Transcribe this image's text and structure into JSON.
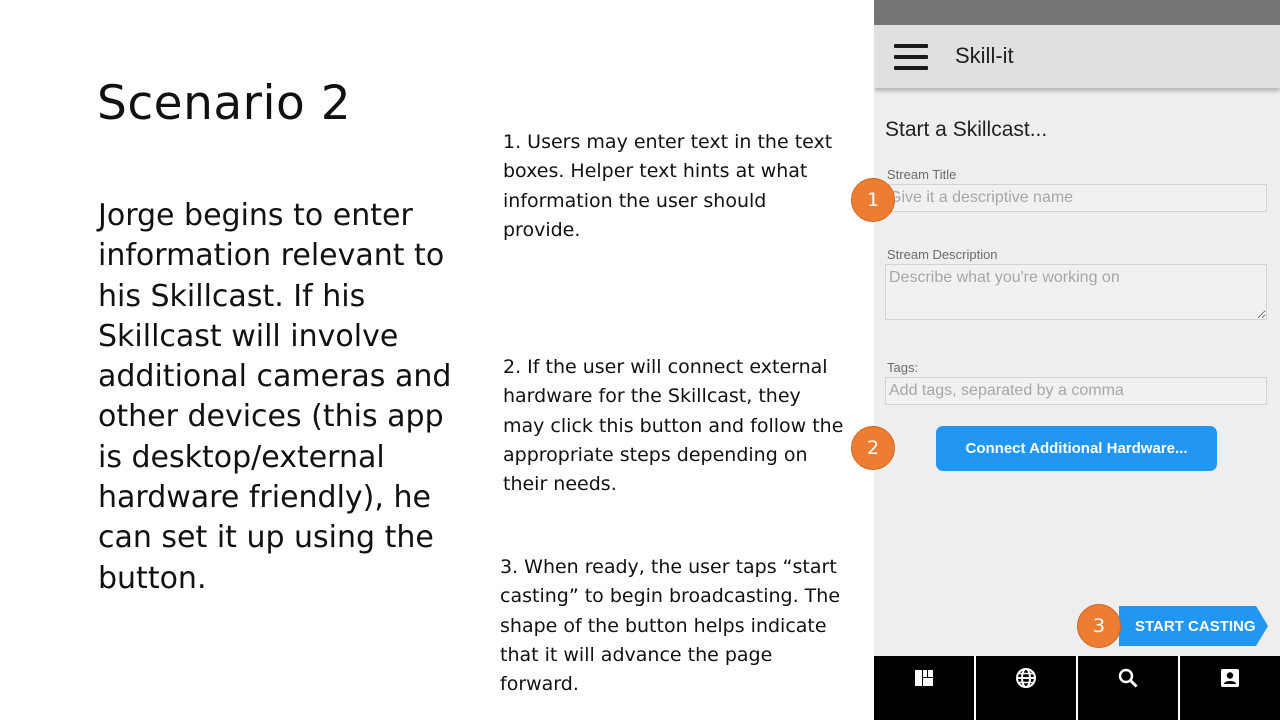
{
  "slide": {
    "title": "Scenario 2",
    "body": "Jorge begins to enter information relevant to his Skillcast. If his Skillcast will involve additional cameras and other devices (this app is desktop/external hardware friendly), he can set it up using the button.",
    "notes": [
      "1. Users may enter text in the text boxes. Helper text hints at what information the user should provide.",
      "2. If the user will connect external hardware for the Skillcast, they may click this button and follow the appropriate steps depending on their needs.",
      "3. When ready, the user taps “start casting” to begin broadcasting. The shape of the button helps indicate that it will advance the page forward."
    ]
  },
  "app": {
    "title": "Skill-it",
    "menu_icon": "hamburger-menu-icon",
    "form": {
      "heading": "Start a Skillcast...",
      "stream_title_label": "Stream Title",
      "stream_title_placeholder": "Give it a descriptive name",
      "stream_title_value": "",
      "stream_description_label": "Stream Description",
      "stream_description_placeholder": "Describe what you're working on",
      "stream_description_value": "",
      "tags_label": "Tags:",
      "tags_placeholder": "Add tags, separated by a comma",
      "tags_value": ""
    },
    "connect_hardware_label": "Connect Additional Hardware...",
    "start_casting_label": "START CASTING",
    "bottom_nav": [
      {
        "icon": "dashboard-icon"
      },
      {
        "icon": "globe-icon"
      },
      {
        "icon": "search-icon"
      },
      {
        "icon": "account-box-icon"
      }
    ]
  },
  "callouts": [
    "1",
    "2",
    "3"
  ],
  "colors": {
    "accent": "#2196f3",
    "callout": "#ed7d31",
    "app_bar": "#e0e0e0",
    "status_bar": "#757575",
    "bottom_nav": "#000000"
  }
}
